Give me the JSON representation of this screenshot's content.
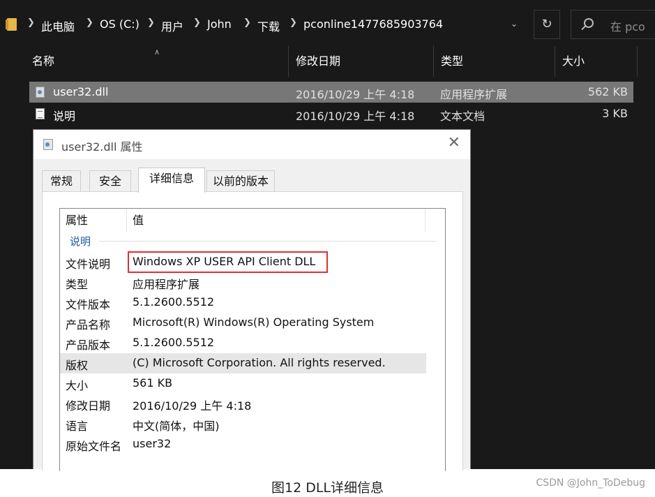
{
  "address_bar": {
    "breadcrumbs": [
      "此电脑",
      "OS (C:)",
      "用户",
      "John",
      "下载",
      "pconline1477685903764"
    ],
    "search_placeholder": "在 pco"
  },
  "file_list": {
    "columns": [
      "名称",
      "修改日期",
      "类型",
      "大小"
    ],
    "files": [
      {
        "name": "user32.dll",
        "date": "2016/10/29 上午 4:18",
        "type": "应用程序扩展",
        "size": "562 KB",
        "icon": "dll-file-icon",
        "selected": true
      },
      {
        "name": "说明",
        "date": "2016/10/29 上午 4:18",
        "type": "文本文档",
        "size": "3 KB",
        "icon": "text-file-icon",
        "selected": false
      }
    ]
  },
  "dialog": {
    "title": "user32.dll 属性",
    "tabs": [
      "常规",
      "安全",
      "详细信息",
      "以前的版本"
    ],
    "active_tab": "详细信息",
    "columns": [
      "属性",
      "值"
    ],
    "group": "说明",
    "properties": [
      {
        "key": "文件说明",
        "value": "Windows XP USER API Client DLL"
      },
      {
        "key": "类型",
        "value": "应用程序扩展"
      },
      {
        "key": "文件版本",
        "value": "5.1.2600.5512"
      },
      {
        "key": "产品名称",
        "value": "Microsoft(R) Windows(R) Operating System"
      },
      {
        "key": "产品版本",
        "value": "5.1.2600.5512"
      },
      {
        "key": "版权",
        "value": "(C) Microsoft Corporation. All rights reserved."
      },
      {
        "key": "大小",
        "value": "561 KB"
      },
      {
        "key": "修改日期",
        "value": "2016/10/29 上午 4:18"
      },
      {
        "key": "语言",
        "value": "中文(简体，中国)"
      },
      {
        "key": "原始文件名",
        "value": "user32"
      }
    ],
    "highlighted_row": "版权",
    "annotated_row": "文件说明"
  },
  "caption": "图12 DLL详细信息",
  "watermark": "CSDN @John_ToDebug",
  "colors": {
    "explorer_bg": "#191919",
    "selected_row": "#777777",
    "annotation_box": "#e03030",
    "group_label": "#1e57a4"
  }
}
